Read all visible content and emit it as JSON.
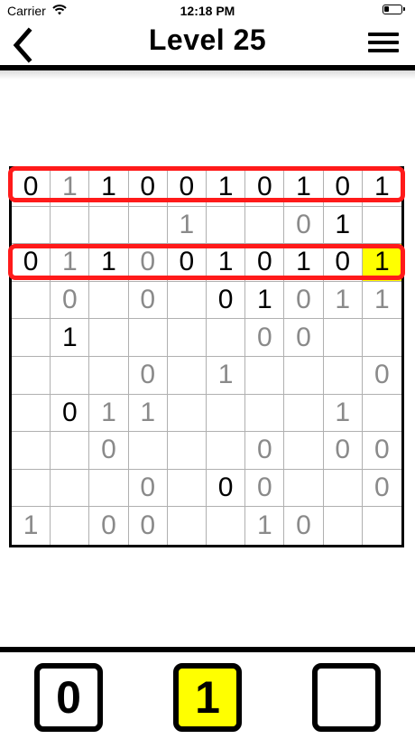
{
  "status": {
    "carrier": "Carrier",
    "time": "12:18 PM"
  },
  "nav": {
    "title": "Level 25",
    "back_icon": "back-chevron-icon",
    "menu_icon": "hamburger-menu-icon"
  },
  "colors": {
    "highlight": "#ffff00",
    "outline": "#ff1a1a",
    "fixed_digit": "#000000",
    "user_digit": "#8a8a8a"
  },
  "board": {
    "size": 10,
    "rows": [
      [
        {
          "v": "0",
          "t": "fixed"
        },
        {
          "v": "1",
          "t": "user"
        },
        {
          "v": "1",
          "t": "fixed"
        },
        {
          "v": "0",
          "t": "fixed"
        },
        {
          "v": "0",
          "t": "fixed"
        },
        {
          "v": "1",
          "t": "fixed"
        },
        {
          "v": "0",
          "t": "fixed"
        },
        {
          "v": "1",
          "t": "fixed"
        },
        {
          "v": "0",
          "t": "fixed"
        },
        {
          "v": "1",
          "t": "fixed"
        }
      ],
      [
        {
          "v": "",
          "t": ""
        },
        {
          "v": "",
          "t": ""
        },
        {
          "v": "",
          "t": ""
        },
        {
          "v": "",
          "t": ""
        },
        {
          "v": "1",
          "t": "user"
        },
        {
          "v": "",
          "t": ""
        },
        {
          "v": "",
          "t": ""
        },
        {
          "v": "0",
          "t": "user"
        },
        {
          "v": "1",
          "t": "fixed"
        },
        {
          "v": "",
          "t": ""
        }
      ],
      [
        {
          "v": "0",
          "t": "fixed"
        },
        {
          "v": "1",
          "t": "user"
        },
        {
          "v": "1",
          "t": "fixed"
        },
        {
          "v": "0",
          "t": "user"
        },
        {
          "v": "0",
          "t": "fixed"
        },
        {
          "v": "1",
          "t": "fixed"
        },
        {
          "v": "0",
          "t": "fixed"
        },
        {
          "v": "1",
          "t": "fixed"
        },
        {
          "v": "0",
          "t": "fixed"
        },
        {
          "v": "1",
          "t": "fixed",
          "hl": true
        }
      ],
      [
        {
          "v": "",
          "t": ""
        },
        {
          "v": "0",
          "t": "user"
        },
        {
          "v": "",
          "t": ""
        },
        {
          "v": "0",
          "t": "user"
        },
        {
          "v": "",
          "t": ""
        },
        {
          "v": "0",
          "t": "fixed"
        },
        {
          "v": "1",
          "t": "fixed"
        },
        {
          "v": "0",
          "t": "user"
        },
        {
          "v": "1",
          "t": "user"
        },
        {
          "v": "1",
          "t": "user"
        }
      ],
      [
        {
          "v": "",
          "t": ""
        },
        {
          "v": "1",
          "t": "fixed"
        },
        {
          "v": "",
          "t": ""
        },
        {
          "v": "",
          "t": ""
        },
        {
          "v": "",
          "t": ""
        },
        {
          "v": "",
          "t": ""
        },
        {
          "v": "0",
          "t": "user"
        },
        {
          "v": "0",
          "t": "user"
        },
        {
          "v": "",
          "t": ""
        },
        {
          "v": "",
          "t": ""
        }
      ],
      [
        {
          "v": "",
          "t": ""
        },
        {
          "v": "",
          "t": ""
        },
        {
          "v": "",
          "t": ""
        },
        {
          "v": "0",
          "t": "user"
        },
        {
          "v": "",
          "t": ""
        },
        {
          "v": "1",
          "t": "user"
        },
        {
          "v": "",
          "t": ""
        },
        {
          "v": "",
          "t": ""
        },
        {
          "v": "",
          "t": ""
        },
        {
          "v": "0",
          "t": "user"
        }
      ],
      [
        {
          "v": "",
          "t": ""
        },
        {
          "v": "0",
          "t": "fixed"
        },
        {
          "v": "1",
          "t": "user"
        },
        {
          "v": "1",
          "t": "user"
        },
        {
          "v": "",
          "t": ""
        },
        {
          "v": "",
          "t": ""
        },
        {
          "v": "",
          "t": ""
        },
        {
          "v": "",
          "t": ""
        },
        {
          "v": "1",
          "t": "user"
        },
        {
          "v": "",
          "t": ""
        }
      ],
      [
        {
          "v": "",
          "t": ""
        },
        {
          "v": "",
          "t": ""
        },
        {
          "v": "0",
          "t": "user"
        },
        {
          "v": "",
          "t": ""
        },
        {
          "v": "",
          "t": ""
        },
        {
          "v": "",
          "t": ""
        },
        {
          "v": "0",
          "t": "user"
        },
        {
          "v": "",
          "t": ""
        },
        {
          "v": "0",
          "t": "user"
        },
        {
          "v": "0",
          "t": "user"
        }
      ],
      [
        {
          "v": "",
          "t": ""
        },
        {
          "v": "",
          "t": ""
        },
        {
          "v": "",
          "t": ""
        },
        {
          "v": "0",
          "t": "user"
        },
        {
          "v": "",
          "t": ""
        },
        {
          "v": "0",
          "t": "fixed"
        },
        {
          "v": "0",
          "t": "user"
        },
        {
          "v": "",
          "t": ""
        },
        {
          "v": "",
          "t": ""
        },
        {
          "v": "0",
          "t": "user"
        }
      ],
      [
        {
          "v": "1",
          "t": "user"
        },
        {
          "v": "",
          "t": ""
        },
        {
          "v": "0",
          "t": "user"
        },
        {
          "v": "0",
          "t": "user"
        },
        {
          "v": "",
          "t": ""
        },
        {
          "v": "",
          "t": ""
        },
        {
          "v": "1",
          "t": "user"
        },
        {
          "v": "0",
          "t": "user"
        },
        {
          "v": "",
          "t": ""
        },
        {
          "v": "",
          "t": ""
        }
      ]
    ]
  },
  "palette": [
    {
      "label": "0",
      "selected": false
    },
    {
      "label": "1",
      "selected": true
    },
    {
      "label": "",
      "selected": false
    }
  ]
}
